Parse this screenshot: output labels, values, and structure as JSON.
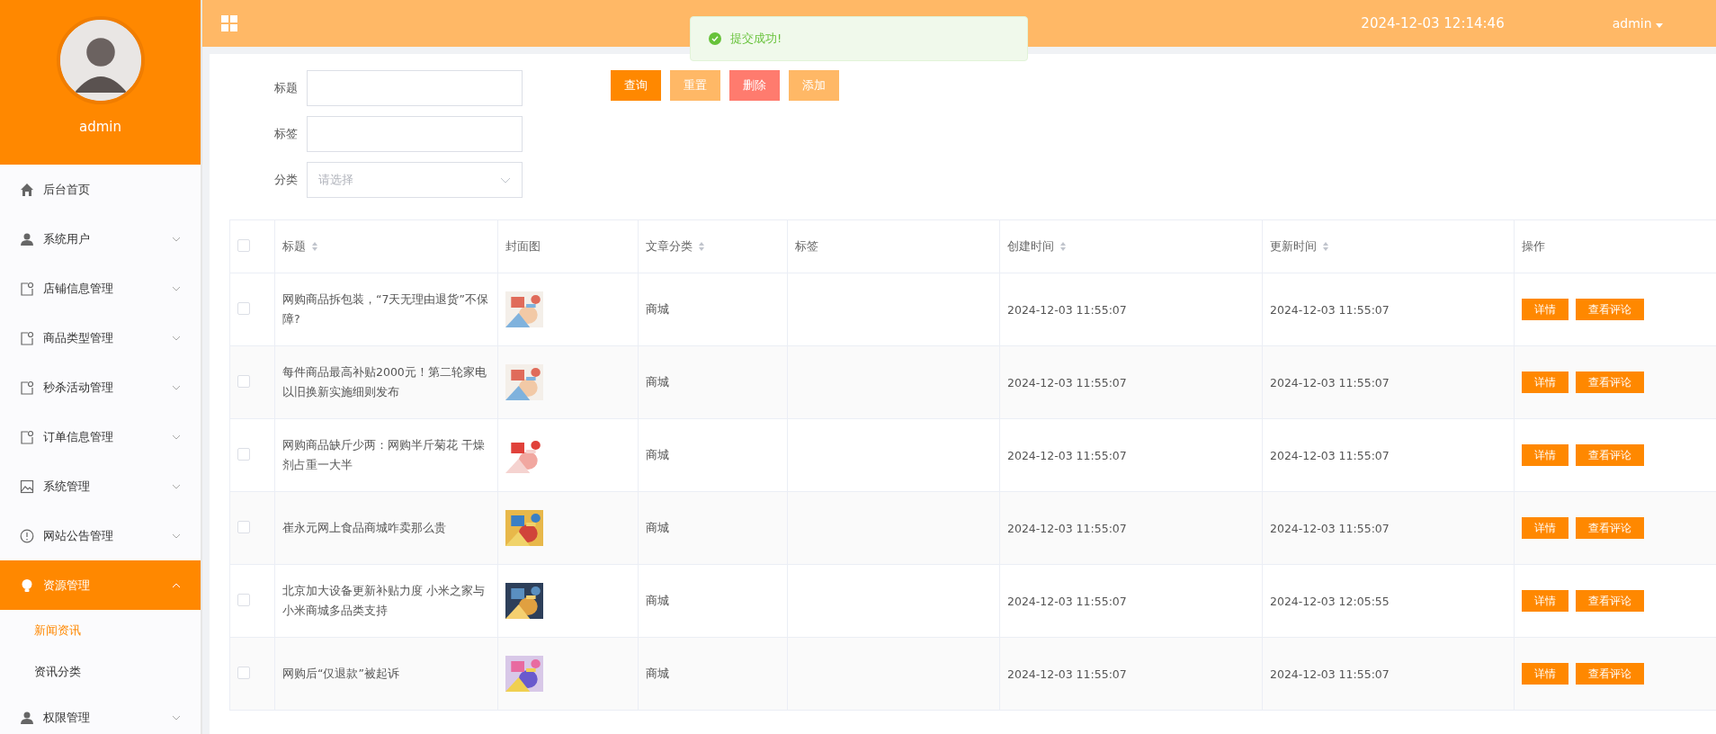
{
  "sidebar": {
    "user": "admin",
    "items": [
      {
        "label": "后台首页",
        "expandable": false,
        "selected": false
      },
      {
        "label": "系统用户",
        "expandable": true,
        "expanded": false,
        "selected": false
      },
      {
        "label": "店铺信息管理",
        "expandable": true,
        "expanded": false,
        "selected": false
      },
      {
        "label": "商品类型管理",
        "expandable": true,
        "expanded": false,
        "selected": false
      },
      {
        "label": "秒杀活动管理",
        "expandable": true,
        "expanded": false,
        "selected": false
      },
      {
        "label": "订单信息管理",
        "expandable": true,
        "expanded": false,
        "selected": false
      },
      {
        "label": "系统管理",
        "expandable": true,
        "expanded": false,
        "selected": false
      },
      {
        "label": "网站公告管理",
        "expandable": true,
        "expanded": false,
        "selected": false
      },
      {
        "label": "资源管理",
        "expandable": true,
        "expanded": true,
        "selected": true,
        "children": [
          {
            "label": "新闻资讯",
            "selected": true
          },
          {
            "label": "资讯分类",
            "selected": false
          }
        ]
      },
      {
        "label": "权限管理",
        "expandable": true,
        "expanded": false,
        "selected": false
      }
    ]
  },
  "header": {
    "datetime": "2024-12-03 12:14:46",
    "user": "admin"
  },
  "toast": {
    "message": "提交成功!"
  },
  "filters": [
    {
      "label": "标题",
      "kind": "input"
    },
    {
      "label": "标签",
      "kind": "input"
    },
    {
      "label": "分类",
      "kind": "select",
      "placeholder": "请选择"
    }
  ],
  "buttons": [
    {
      "label": "查询",
      "color": "#ff8800"
    },
    {
      "label": "重置",
      "color": "#ffb866"
    },
    {
      "label": "删除",
      "color": "#ff7b6e"
    },
    {
      "label": "添加",
      "color": "#ffb866"
    }
  ],
  "table": {
    "all_checked": false,
    "columns": [
      {
        "label": "标题",
        "sortable": true
      },
      {
        "label": "封面图",
        "sortable": false
      },
      {
        "label": "文章分类",
        "sortable": true
      },
      {
        "label": "标签",
        "sortable": false
      },
      {
        "label": "创建时间",
        "sortable": true
      },
      {
        "label": "更新时间",
        "sortable": true
      },
      {
        "label": "操作",
        "sortable": false
      }
    ],
    "rows": [
      {
        "checked": false,
        "title": "网购商品拆包装，“7天无理由退货”不保障?",
        "cover": {
          "kind": "picture"
        },
        "category": "商城",
        "created": "2024-12-03 11:55:07",
        "updated": "2024-12-03 11:55:07",
        "actions": [
          "详情",
          "查看评论"
        ]
      },
      {
        "checked": false,
        "title": "每件商品最高补贴2000元！第二轮家电以旧换新实施细则发布",
        "cover": {
          "kind": "picture"
        },
        "category": "商城",
        "created": "2024-12-03 11:55:07",
        "updated": "2024-12-03 11:55:07",
        "actions": [
          "详情",
          "查看评论"
        ]
      },
      {
        "checked": false,
        "title": "网购商品缺斤少两：网购半斤菊花 干燥剂占重一大半",
        "cover": {
          "kind": "picture"
        },
        "category": "商城",
        "created": "2024-12-03 11:55:07",
        "updated": "2024-12-03 11:55:07",
        "actions": [
          "详情",
          "查看评论"
        ]
      },
      {
        "checked": false,
        "title": "崔永元网上食品商城咋卖那么贵",
        "cover": {
          "kind": "picture"
        },
        "category": "商城",
        "created": "2024-12-03 11:55:07",
        "updated": "2024-12-03 11:55:07",
        "actions": [
          "详情",
          "查看评论"
        ]
      },
      {
        "checked": false,
        "title": "北京加大设备更新补贴力度 小米之家与小米商城多品类支持",
        "cover": {
          "kind": "picture"
        },
        "category": "商城",
        "created": "2024-12-03 11:55:07",
        "updated": "2024-12-03 12:05:55",
        "actions": [
          "详情",
          "查看评论"
        ]
      },
      {
        "checked": false,
        "title": "网购后“仅退款”被起诉",
        "cover": {
          "kind": "picture"
        },
        "category": "商城",
        "created": "2024-12-03 11:55:07",
        "updated": "2024-12-03 11:55:07",
        "actions": [
          "详情",
          "查看评论"
        ]
      }
    ]
  }
}
